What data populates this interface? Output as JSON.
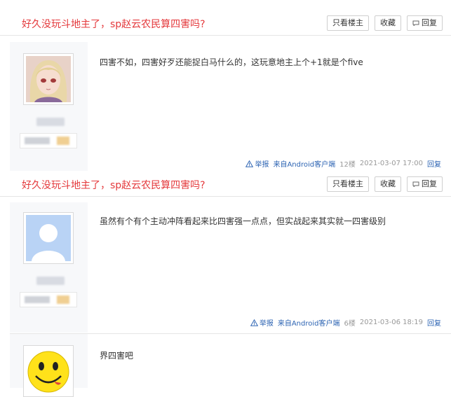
{
  "header": {
    "title": "好久没玩斗地主了，sp赵云农民算四害吗?",
    "buttons": {
      "only_op": "只看楼主",
      "favorite": "收藏",
      "reply": "回复"
    }
  },
  "posts": [
    {
      "content": "四害不如，四害好歹还能捉白马什么的，这玩意地主上个+1就是个five",
      "footer": {
        "report": "举报",
        "client": "来自Android客户端",
        "floor": "12楼",
        "time": "2021-03-07 17:00",
        "reply": "回复"
      }
    },
    {
      "content": "虽然有个有个主动冲阵看起来比四害强一点点，但实战起来其实就一四害级别",
      "footer": {
        "report": "举报",
        "client": "来自Android客户端",
        "floor": "6楼",
        "time": "2021-03-06 18:19",
        "reply": "回复"
      }
    },
    {
      "content": "界四害吧"
    }
  ],
  "colors": {
    "title": "#e4393c",
    "link": "#2d64b3",
    "sidebar_bg": "#f7f8fa"
  },
  "icons": {
    "warning": "warning-triangle-icon",
    "reply": "speech-bubble-icon"
  }
}
